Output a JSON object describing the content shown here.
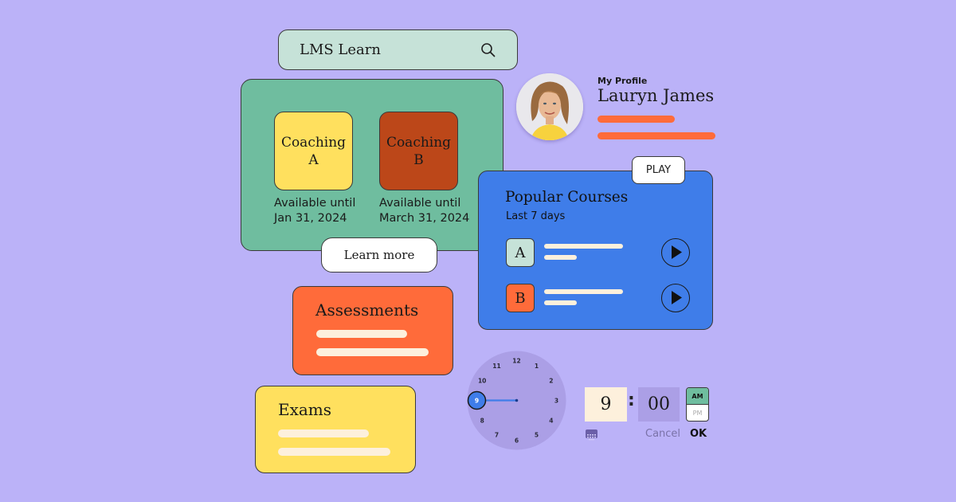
{
  "colors": {
    "background": "#bbb2f8",
    "search_bg": "#c6e2d8",
    "coaching_bg": "#6fbd9f",
    "coaching_a": "#ffe05e",
    "coaching_b": "#bc4719",
    "accent_orange": "#ff6b3a",
    "accent_blue": "#3f7de9",
    "cream": "#fdf0dc"
  },
  "search": {
    "value": "LMS Learn",
    "icon": "search-icon"
  },
  "coaching": {
    "tiles": [
      {
        "line1": "Coaching",
        "line2": "A",
        "avail_label": "Available until",
        "avail_date": "Jan 31, 2024"
      },
      {
        "line1": "Coaching",
        "line2": "B",
        "avail_label": "Available until",
        "avail_date": "March 31, 2024"
      }
    ],
    "learn_more_label": "Learn more"
  },
  "profile": {
    "caption": "My Profile",
    "name": "Lauryn James"
  },
  "popular": {
    "play_label": "PLAY",
    "title": "Popular Courses",
    "subtitle": "Last 7 days",
    "courses": [
      {
        "badge": "A",
        "icon": "play-icon"
      },
      {
        "badge": "B",
        "icon": "play-icon"
      }
    ]
  },
  "assessments": {
    "title": "Assessments"
  },
  "exams": {
    "title": "Exams"
  },
  "clock": {
    "numbers": [
      "12",
      "1",
      "2",
      "3",
      "4",
      "5",
      "6",
      "7",
      "8",
      "9",
      "10",
      "11"
    ],
    "selected_hour": "9"
  },
  "time_picker": {
    "hour": "9",
    "separator": ":",
    "minute": "00",
    "am_label": "AM",
    "pm_label": "PM",
    "selected_period": "AM",
    "cancel_label": "Cancel",
    "ok_label": "OK",
    "keyboard_icon": "keyboard-icon"
  }
}
